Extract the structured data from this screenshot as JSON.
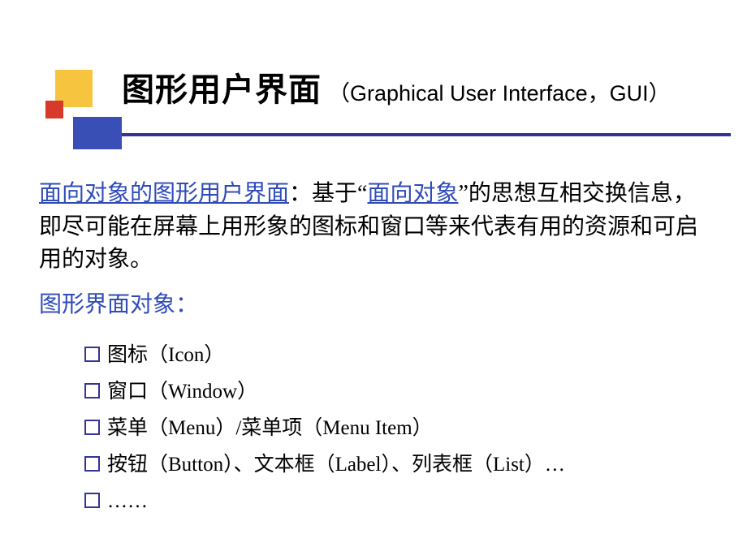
{
  "title": {
    "main": "图形用户界面",
    "sub": "（Graphical User Interface，GUI）"
  },
  "paragraph1": {
    "link1": "面向对象的图形用户界面",
    "t1": "：基于“",
    "link2": "面向对象",
    "t2": "”的思想互相交换信息，即尽可能在屏幕上用形象的图标和窗口等来代表有用的资源和可启用的对象。"
  },
  "paragraph2": "图形界面对象：",
  "list": [
    "图标（Icon）",
    "窗口（Window）",
    "菜单（Menu）/菜单项（Menu Item）",
    "按钮（Button）、文本框（Label）、列表框（List）…",
    "……"
  ]
}
